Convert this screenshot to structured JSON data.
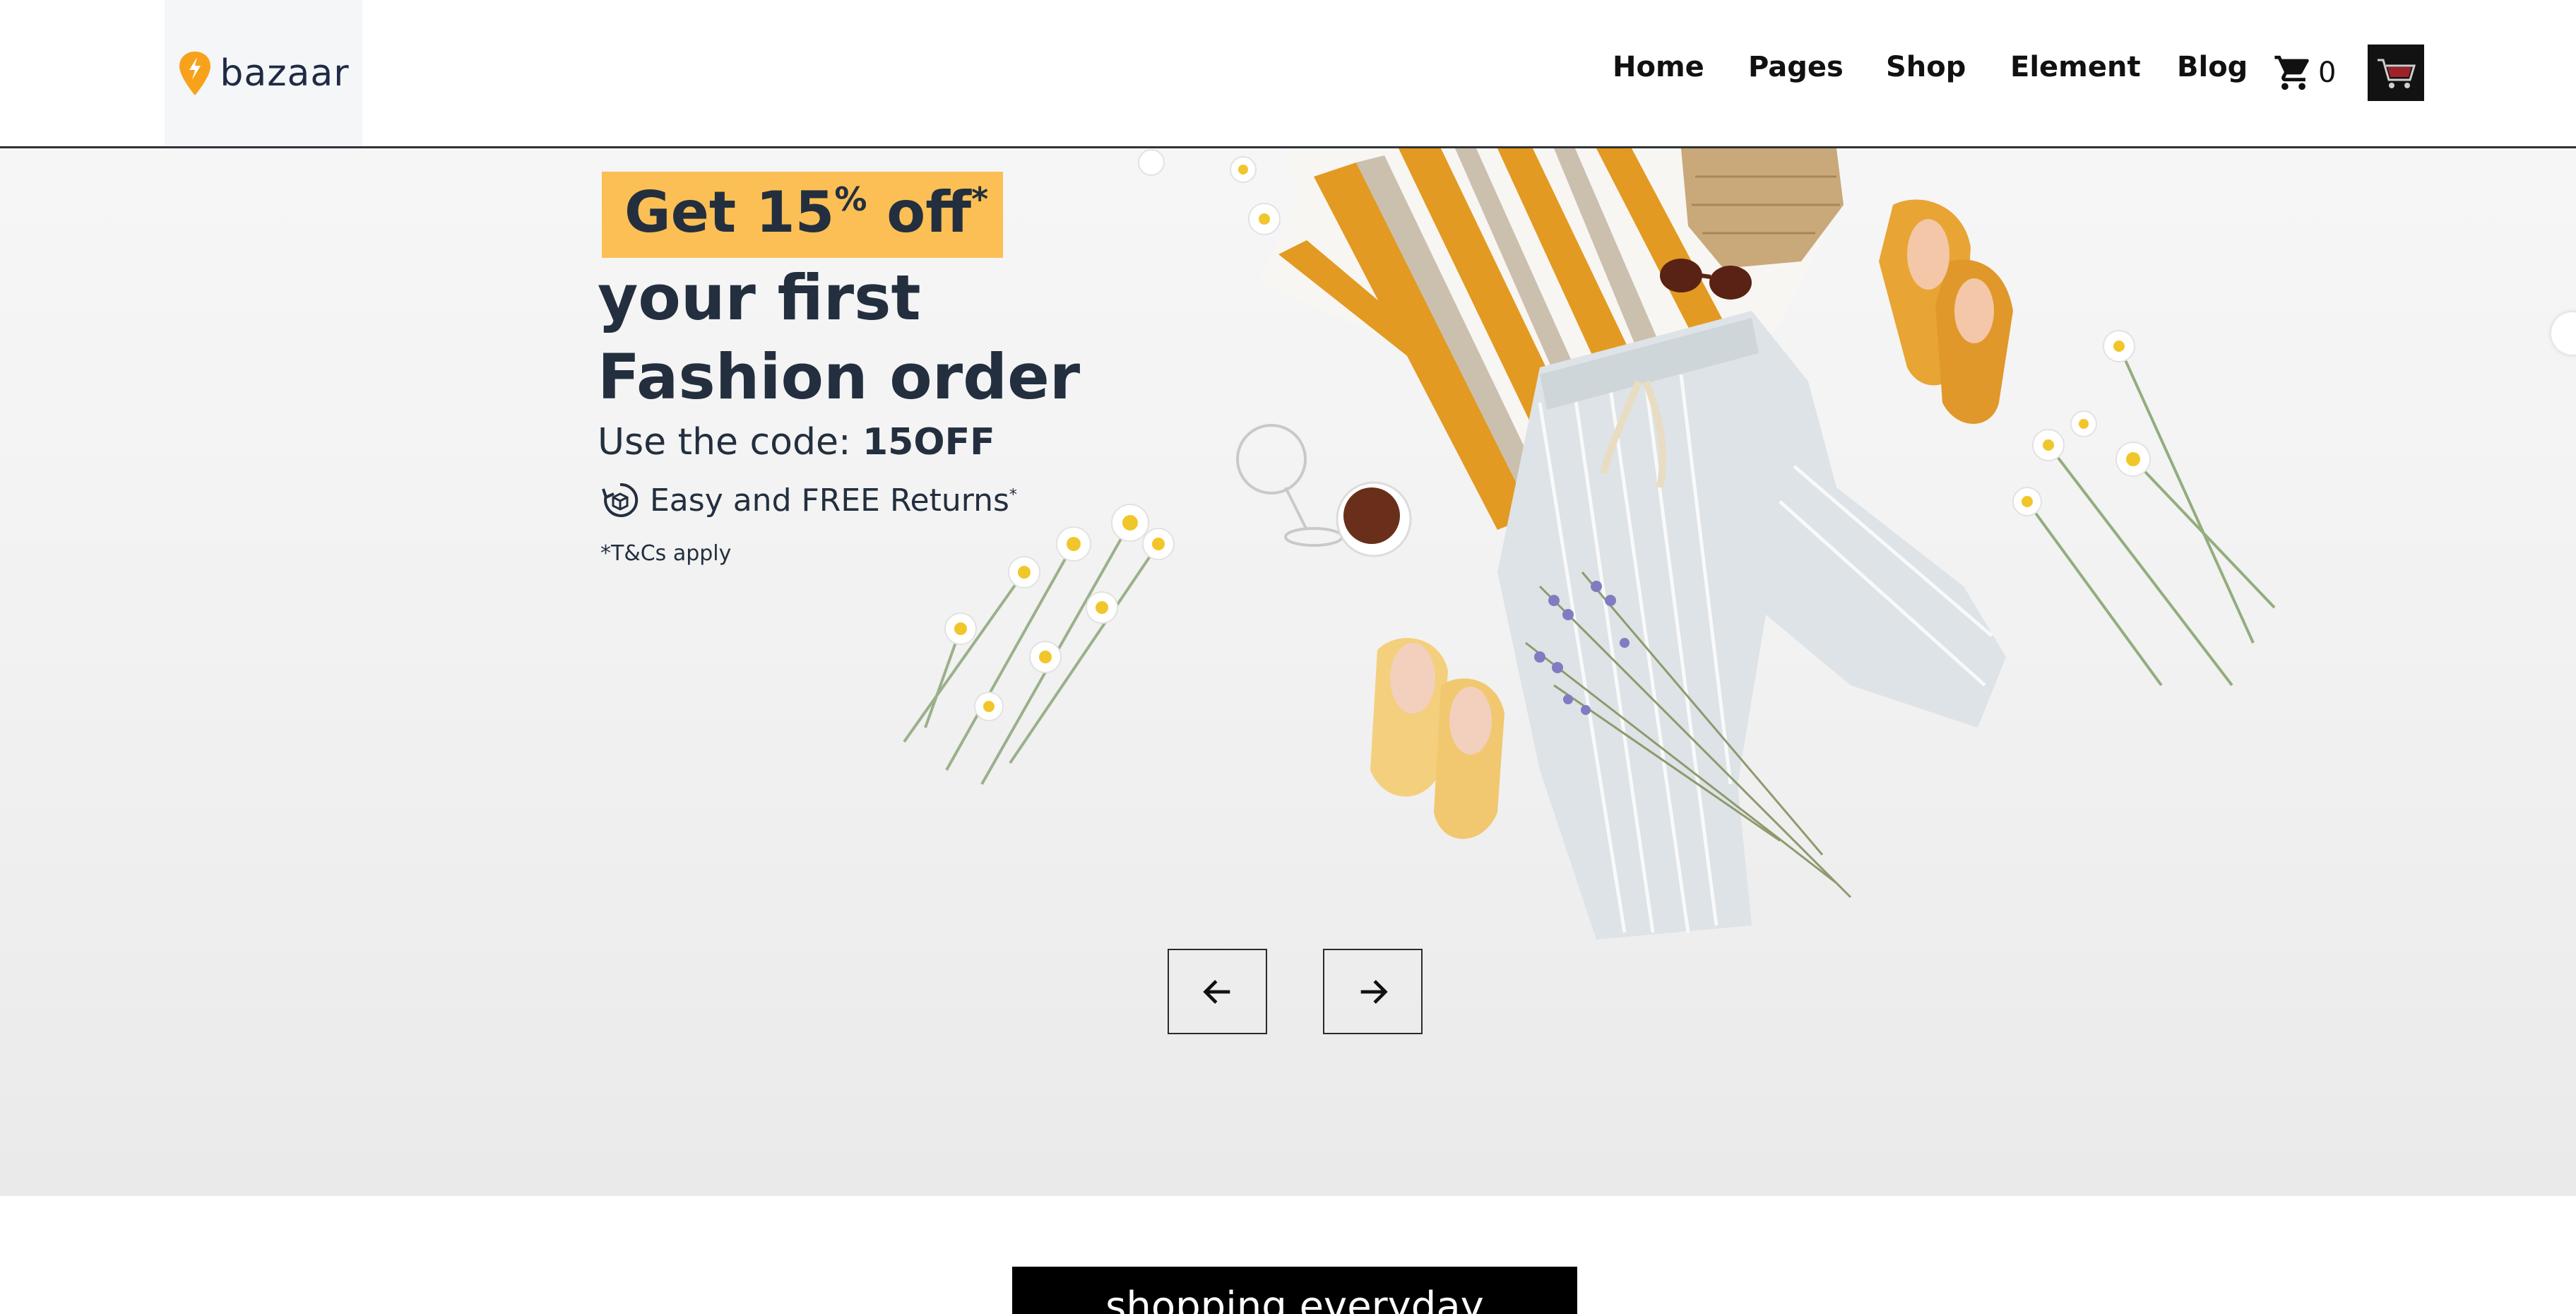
{
  "header": {
    "logo_text": "bazaar",
    "nav": [
      {
        "label": "Home"
      },
      {
        "label": "Pages"
      },
      {
        "label": "Shop"
      },
      {
        "label": "Element"
      },
      {
        "label": "Blog"
      }
    ],
    "cart_count": "0",
    "cart_icon": "shopping-cart-icon",
    "avatar_icon": "cart-image-avatar"
  },
  "hero": {
    "badge_prefix": "Get 15",
    "badge_percent": "%",
    "badge_suffix": " off",
    "badge_asterisk": "*",
    "headline_line1": "your first",
    "headline_line2": "Fashion order",
    "code_prefix": "Use the code: ",
    "code_value": "15OFF",
    "returns_text": "Easy and FREE Returns",
    "returns_asterisk": "*",
    "returns_icon": "returns-box-icon",
    "terms": "*T&Cs apply",
    "prev_icon": "arrow-left-icon",
    "next_icon": "arrow-right-icon"
  },
  "promo": {
    "text": "shopping everyday"
  },
  "colors": {
    "accent": "#fbbf55",
    "heading": "#232f3e",
    "logo_pin": "#f7a21a"
  }
}
